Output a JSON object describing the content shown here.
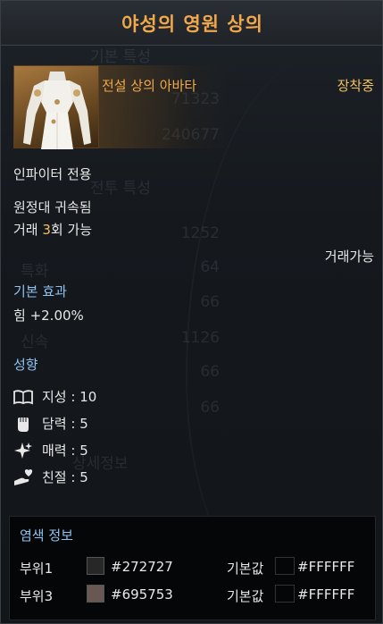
{
  "title": "야성의 영원 상의",
  "item_grade_label": "전설 상의 아바타",
  "equip_status": "장착중",
  "class_restriction": "인파이터 전용",
  "binding": "원정대 귀속됨",
  "trade": {
    "prefix": "거래 ",
    "count": "3",
    "suffix": "회 가능"
  },
  "trade_status": "거래가능",
  "base_effect": {
    "label": "기본 효과",
    "value": "힘 +2.00%"
  },
  "tendency": {
    "label": "성향",
    "items": [
      {
        "icon": "book-icon",
        "text": "지성 : 10"
      },
      {
        "icon": "fist-icon",
        "text": "담력 : 5"
      },
      {
        "icon": "sparkle-icon",
        "text": "매력 : 5"
      },
      {
        "icon": "heart-hand-icon",
        "text": "친절 : 5"
      }
    ]
  },
  "dye": {
    "label": "염색 정보",
    "base_label": "기본값",
    "rows": [
      {
        "part": "부위1",
        "color": "#272727",
        "base": "#FFFFFF"
      },
      {
        "part": "부위3",
        "color": "#695753",
        "base": "#FFFFFF"
      }
    ]
  },
  "colors": {
    "title": "#f0a84a",
    "section": "#8ec3f0",
    "highlight": "#f0c060"
  }
}
